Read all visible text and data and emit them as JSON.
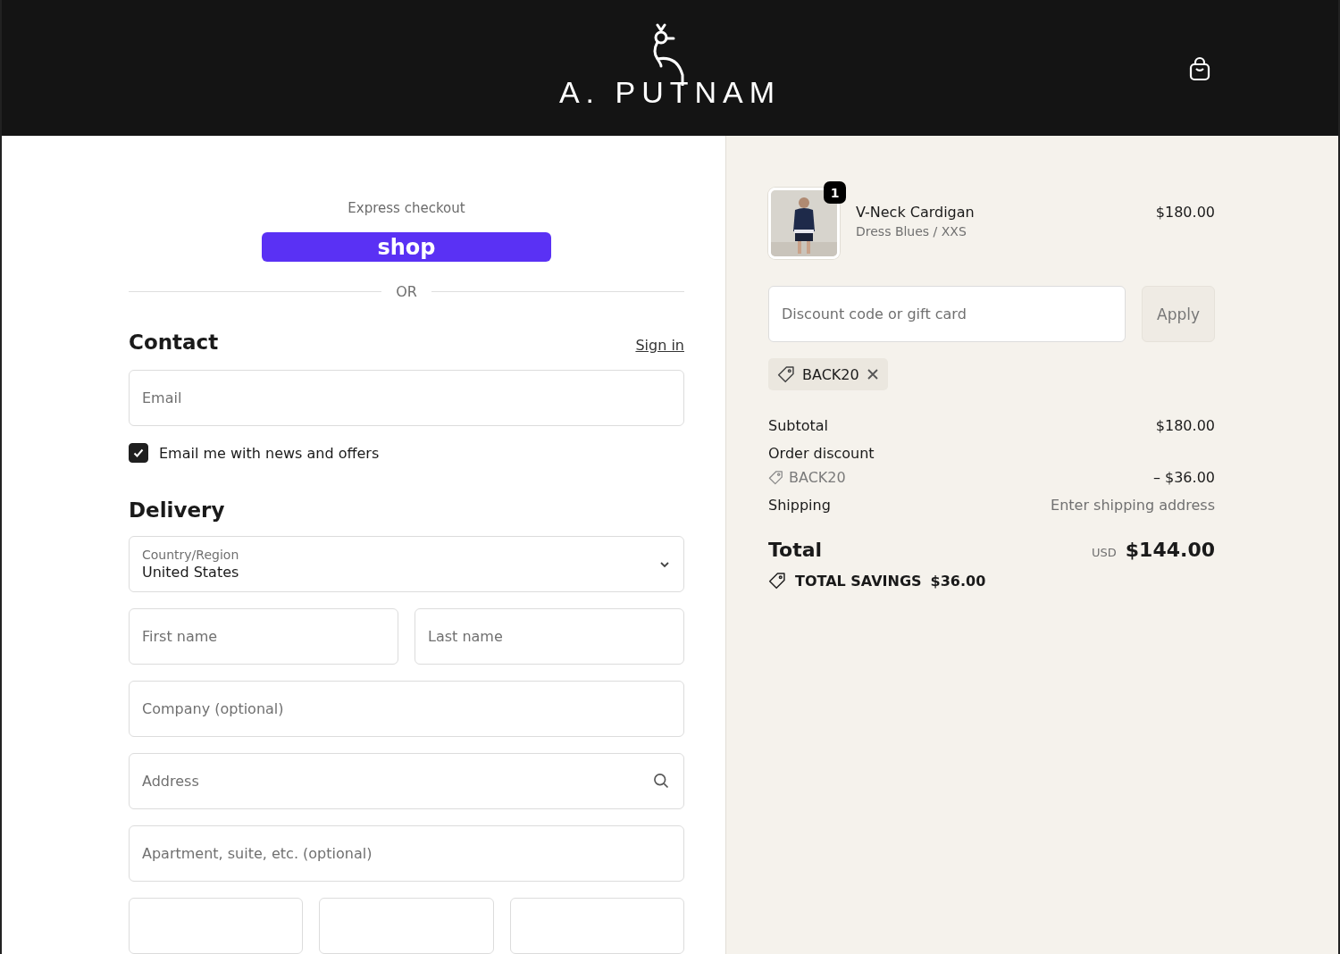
{
  "header": {
    "logo": "A. PUTNAM"
  },
  "express": {
    "label": "Express checkout",
    "shop_button": "shop",
    "divider": "OR"
  },
  "contact": {
    "heading": "Contact",
    "sign_in": "Sign in",
    "email": {
      "placeholder": "Email"
    },
    "newsletter": {
      "label": "Email me with news and offers",
      "checked": true
    }
  },
  "delivery": {
    "heading": "Delivery",
    "country": {
      "label": "Country/Region",
      "value": "United States"
    },
    "rows": [
      [
        {
          "kind": "text",
          "placeholder": "First name"
        },
        {
          "kind": "text",
          "placeholder": "Last name"
        }
      ],
      [
        {
          "kind": "text",
          "placeholder": "Company (optional)"
        }
      ],
      [
        {
          "kind": "search",
          "placeholder": "Address"
        }
      ],
      [
        {
          "kind": "text",
          "placeholder": "Apartment, suite, etc. (optional)"
        }
      ],
      [
        {
          "kind": "text"
        },
        {
          "kind": "text"
        },
        {
          "kind": "text"
        }
      ]
    ]
  },
  "summary": {
    "item": {
      "kind": "picture",
      "quantity": "1",
      "name": "V-Neck Cardigan",
      "variant": "Dress Blues / XXS",
      "price": "$180.00"
    },
    "discount": {
      "placeholder": "Discount code or gift card",
      "button": "Apply"
    },
    "applied_code": "BACK20",
    "lines": [
      {
        "kind": "plain",
        "label": "Subtotal",
        "value": "$180.00"
      },
      {
        "kind": "discount",
        "label": "Order discount",
        "code": "BACK20",
        "value": "– $36.00"
      },
      {
        "kind": "muted",
        "label": "Shipping",
        "value": "Enter shipping address"
      }
    ],
    "total": {
      "label": "Total",
      "currency": "USD",
      "amount": "$144.00"
    },
    "savings": {
      "label": "TOTAL SAVINGS",
      "amount": "$36.00"
    }
  }
}
